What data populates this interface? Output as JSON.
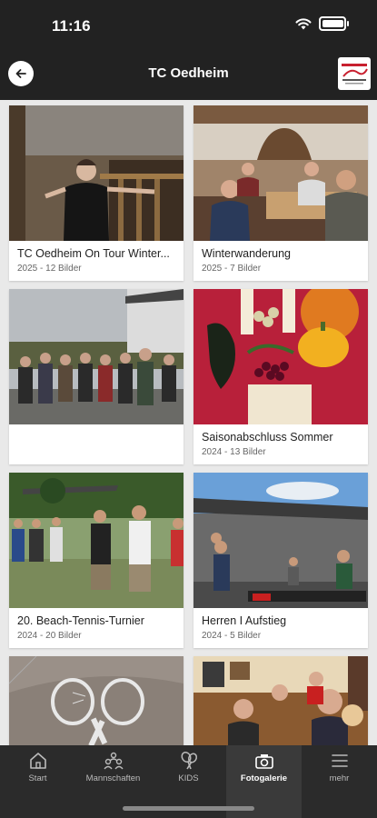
{
  "status_bar": {
    "time": "11:16",
    "battery_level": 0.9
  },
  "header": {
    "title": "TC Oedheim",
    "logo_icon": "club-logo"
  },
  "gallery": [
    {
      "title": "TC Oedheim On Tour Winter...",
      "subtitle": "2025 - 12 Bilder"
    },
    {
      "title": "Winterwanderung",
      "subtitle": "2025 - 7 Bilder"
    },
    {
      "title": "",
      "subtitle": ""
    },
    {
      "title": "Saisonabschluss Sommer",
      "subtitle": "2024 - 13 Bilder"
    },
    {
      "title": "20. Beach-Tennis-Turnier",
      "subtitle": "2024 - 20 Bilder"
    },
    {
      "title": "Herren I Aufstieg",
      "subtitle": "2024 - 5 Bilder"
    },
    {
      "title": "",
      "subtitle": ""
    },
    {
      "title": "",
      "subtitle": ""
    }
  ],
  "tabs": [
    {
      "label": "Start",
      "icon": "home-icon"
    },
    {
      "label": "Mannschaften",
      "icon": "teams-icon"
    },
    {
      "label": "KIDS",
      "icon": "tennis-rackets-icon"
    },
    {
      "label": "Fotogalerie",
      "icon": "camera-icon",
      "active": true
    },
    {
      "label": "mehr",
      "icon": "menu-icon"
    }
  ]
}
